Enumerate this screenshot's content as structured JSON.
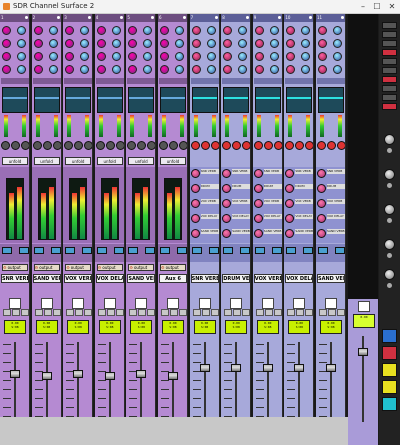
{
  "window": {
    "title": "SDR Channel Surface 2",
    "min": "–",
    "max": "☐",
    "close": "✕"
  },
  "colors": {
    "purple_strip": "#b58ad2",
    "blue_strip": "#a7a9da",
    "lcd": "#c8f000",
    "red_button": "#d03040",
    "blue_button": "#2a6fd0"
  },
  "strips": [
    {
      "num": "1",
      "name": "SNR VERB",
      "kind": "p",
      "insert": "unfold",
      "output": "output",
      "lcd": [
        "0.00",
        "S:08"
      ],
      "fader": 0.62
    },
    {
      "num": "2",
      "name": "SAND VERB",
      "kind": "p",
      "insert": "unfold",
      "output": "output",
      "lcd": [
        "0.00",
        "S:08"
      ],
      "fader": 0.6
    },
    {
      "num": "3",
      "name": "VOX VERB",
      "kind": "p",
      "insert": "unfold",
      "output": "output",
      "lcd": [
        "0.00",
        "S:08"
      ],
      "fader": 0.62
    },
    {
      "num": "4",
      "name": "VOX DELAY",
      "kind": "p",
      "insert": "unfold",
      "output": "output",
      "lcd": [
        "0.00",
        "S:08"
      ],
      "fader": 0.6
    },
    {
      "num": "5",
      "name": "SAND VERB",
      "kind": "p",
      "insert": "unfold",
      "output": "output",
      "lcd": [
        "0.00",
        "S:08"
      ],
      "fader": 0.62
    },
    {
      "num": "6",
      "name": "Aux 6",
      "kind": "p",
      "insert": "unfold",
      "output": "output",
      "lcd": [
        "0.00",
        "S:08"
      ],
      "fader": 0.6
    },
    {
      "num": "7",
      "name": "SNR VERB",
      "kind": "b",
      "insert": "",
      "output": "",
      "lcd": [
        "0.00",
        "S:08"
      ],
      "fader": 0.7
    },
    {
      "num": "8",
      "name": "DRUM VERB",
      "kind": "b",
      "insert": "",
      "output": "",
      "lcd": [
        "0.00",
        "S:08"
      ],
      "fader": 0.7
    },
    {
      "num": "9",
      "name": "VOX VERB",
      "kind": "b",
      "insert": "",
      "output": "",
      "lcd": [
        "0.00",
        "S:08"
      ],
      "fader": 0.7
    },
    {
      "num": "10",
      "name": "VOX DELAY",
      "kind": "b",
      "insert": "",
      "output": "",
      "lcd": [
        "0.00",
        "S:08"
      ],
      "fader": 0.7
    },
    {
      "num": "11",
      "name": "SAND VERB",
      "kind": "b",
      "insert": "",
      "output": "",
      "lcd": [
        "0.00",
        "S:08"
      ],
      "fader": 0.7
    }
  ],
  "send_labels": [
    "SNR VERB",
    "DRUM VERB",
    "VOX VERB",
    "VOX DELAY",
    "SAND VERB"
  ],
  "master": {
    "lcd": [
      "0.00",
      ""
    ],
    "fader": 0.82
  },
  "right_buttons": [
    "",
    "",
    "",
    "",
    "",
    "",
    "",
    "",
    "",
    ""
  ],
  "right_colors": [
    "#555",
    "#555",
    "#555",
    "#d03040",
    "#555",
    "#555",
    "#d03040",
    "#555",
    "#555",
    "#d03040"
  ]
}
